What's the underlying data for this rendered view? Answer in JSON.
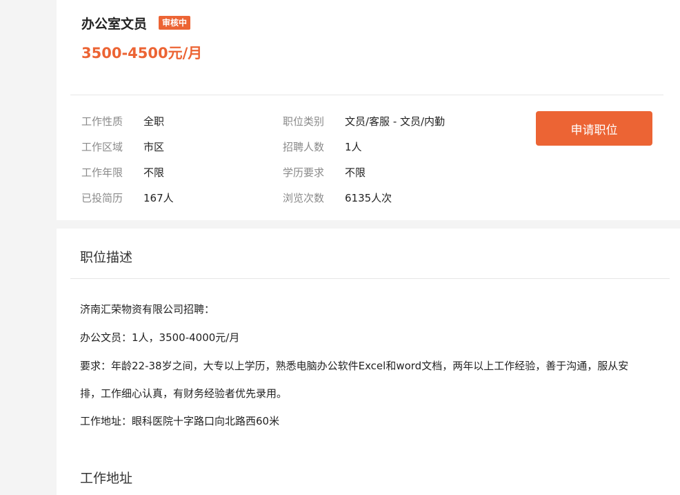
{
  "job": {
    "title": "办公室文员",
    "status_badge": "审核中",
    "salary": "3500-4500元/月"
  },
  "info": {
    "left": [
      {
        "label": "工作性质",
        "value": "全职"
      },
      {
        "label": "工作区域",
        "value": "市区"
      },
      {
        "label": "工作年限",
        "value": "不限"
      },
      {
        "label": "已投简历",
        "value": "167人"
      }
    ],
    "right": [
      {
        "label": "职位类别",
        "value": "文员/客服 - 文员/内勤"
      },
      {
        "label": "招聘人数",
        "value": "1人"
      },
      {
        "label": "学历要求",
        "value": "不限"
      },
      {
        "label": "浏览次数",
        "value": "6135人次"
      }
    ]
  },
  "apply_button_label": "申请职位",
  "description": {
    "title": "职位描述",
    "lines": [
      "济南汇荣物资有限公司招聘：",
      "办公文员：1人，3500-4000元/月",
      "要求：年龄22-38岁之间，大专以上学历，熟悉电脑办公软件Excel和word文档，两年以上工作经验，善于沟通，服从安",
      "排，工作细心认真，有财务经验者优先录用。",
      "工作地址：眼科医院十字路口向北路西60米"
    ]
  },
  "address_section_title": "工作地址",
  "colors": {
    "accent": "#ec6434",
    "label_gray": "#8a8a8a",
    "page_bg": "#f4f4f4"
  }
}
